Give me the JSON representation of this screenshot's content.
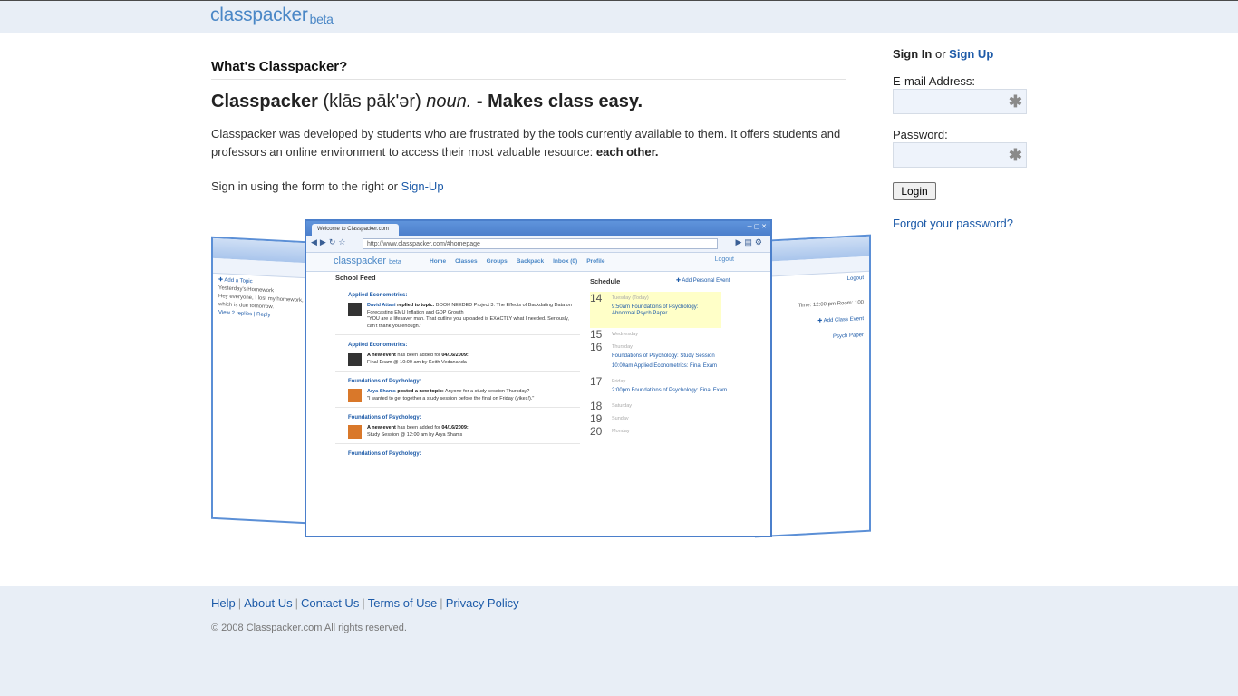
{
  "header": {
    "logo": "classpacker",
    "logo_beta": "beta"
  },
  "main": {
    "section_title": "What's Classpacker?",
    "headline": {
      "name": "Classpacker",
      "pronunciation": "(klās pāk'ər)",
      "pos": "noun.",
      "tagline": "- Makes class easy."
    },
    "description": "Classpacker was developed by students who are frustrated by the tools currently available to them. It offers students and professors an online environment to access their most valuable resource:",
    "description_emphasis": "each other.",
    "signin_prompt": "Sign in using the form to the right or",
    "signin_link": "Sign-Up"
  },
  "preview": {
    "tab_title": "Welcome to Classpacker.com",
    "url": "http://www.classpacker.com/#homepage",
    "app_logo": "classpacker",
    "app_beta": "beta",
    "nav": [
      "Home",
      "Classes",
      "Groups",
      "Backpack",
      "Inbox (0)",
      "Profile"
    ],
    "logout": "Logout",
    "feed_title": "School Feed",
    "feed": [
      {
        "category": "Applied Econometrics:",
        "author": "David Attaei",
        "action": "replied to topic:",
        "text": "BOOK NEEDED Project 3: The Effects of Backdating Data on Forecasting EMU Inflation and GDP Growth",
        "quote": "\"YOU are a lifesaver man. That outline you uploaded is EXACTLY what I needed. Seriously, can't thank you enough.\""
      },
      {
        "category": "Applied Econometrics:",
        "author": "A new event",
        "action": "has been added for",
        "text": "04/16/2009:",
        "quote": "Final Exam @ 10:00 am by Keith Vedananda"
      },
      {
        "category": "Foundations of Psychology:",
        "author": "Arya Shams",
        "action": "posted a new topic:",
        "text": "Anyone for a study session Thursday?",
        "quote": "\"I wanted to get together a study session before the final on Friday (yikes!).\""
      },
      {
        "category": "Foundations of Psychology:",
        "author": "A new event",
        "action": "has been added for",
        "text": "04/16/2009:",
        "quote": "Study Session @ 12:00 am by Arya Shams"
      }
    ],
    "last_category": "Foundations of Psychology:",
    "schedule_title": "Schedule",
    "add_event": "Add Personal Event",
    "schedule": [
      {
        "day": "14",
        "label": "Tuesday (Today)",
        "events": [
          "9:50am Foundations of Psychology: Abnormal Psych Paper"
        ]
      },
      {
        "day": "15",
        "label": "Wednesday",
        "events": []
      },
      {
        "day": "16",
        "label": "Thursday",
        "events": [
          "Foundations of Psychology: Study Session",
          "10:00am Applied Econometrics: Final Exam"
        ]
      },
      {
        "day": "17",
        "label": "Friday",
        "events": [
          "2:00pm Foundations of Psychology: Final Exam"
        ]
      },
      {
        "day": "18",
        "label": "Saturday",
        "events": []
      },
      {
        "day": "19",
        "label": "Sunday",
        "events": []
      },
      {
        "day": "20",
        "label": "Monday",
        "events": []
      }
    ]
  },
  "signin": {
    "title_strong": "Sign In",
    "title_or": "or",
    "signup_link": "Sign Up",
    "email_label": "E-mail Address:",
    "password_label": "Password:",
    "required_glyph": "✱",
    "login_button": "Login",
    "forgot_link": "Forgot your password?"
  },
  "footer": {
    "links": [
      "Help",
      "About Us",
      "Contact Us",
      "Terms of Use",
      "Privacy Policy"
    ],
    "copyright": "© 2008 Classpacker.com All rights reserved."
  }
}
